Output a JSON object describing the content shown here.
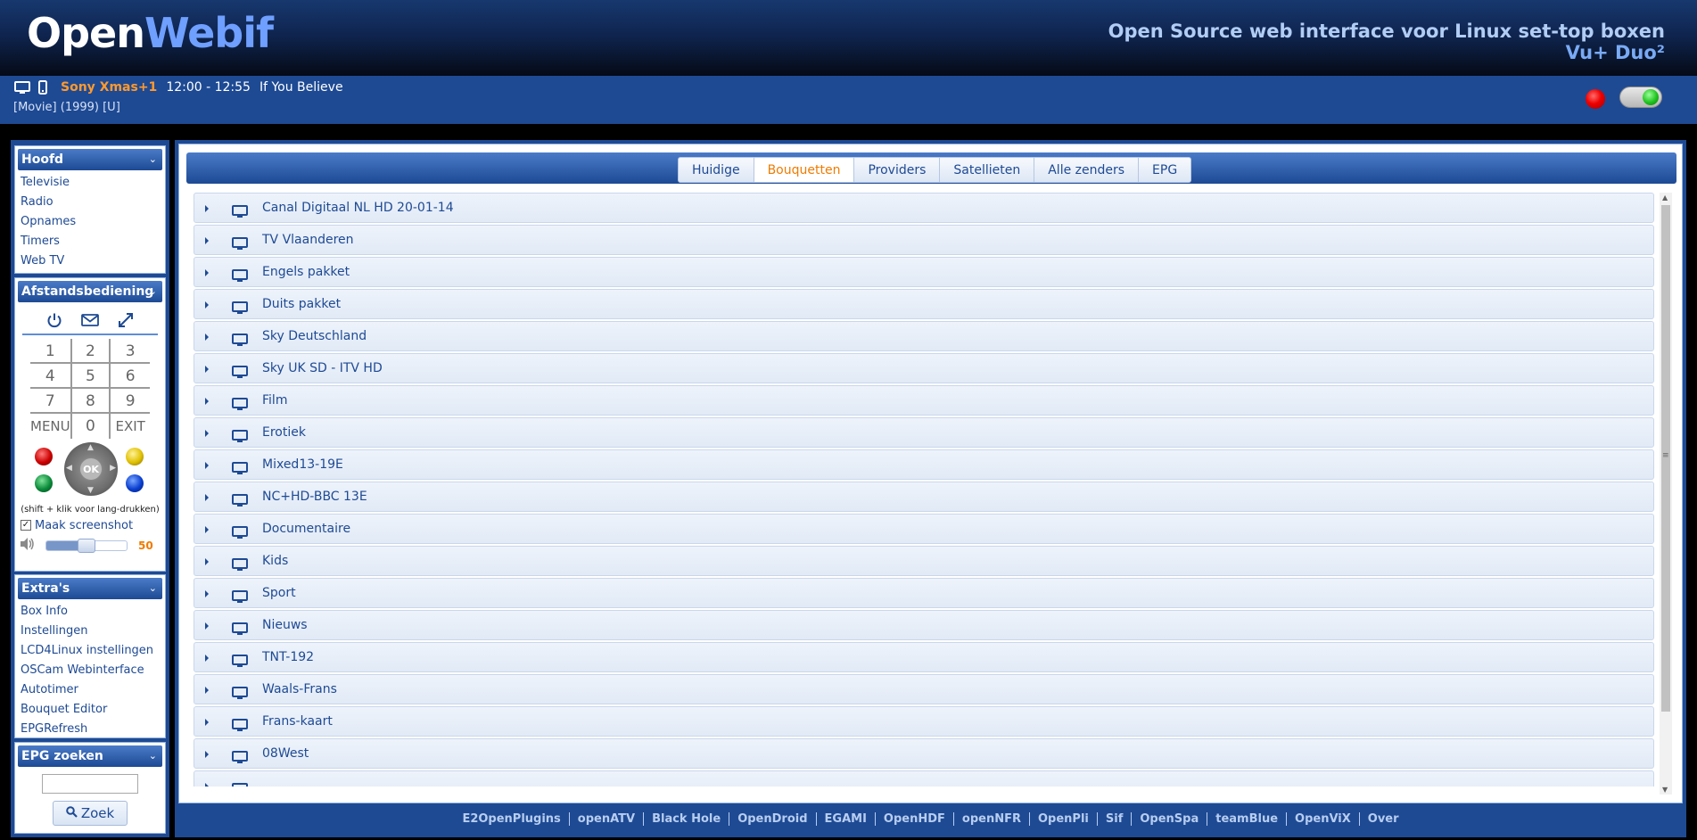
{
  "header": {
    "logo_part1": "Open",
    "logo_part2": "Webif",
    "tagline": "Open Source web interface voor Linux set-top boxen",
    "model": "Vu+ Duo²"
  },
  "now_playing": {
    "channel": "Sony Xmas+1",
    "time": "12:00 - 12:55",
    "title": "If You Believe",
    "details": "[Movie] (1999) [U]"
  },
  "sidebar": {
    "main": {
      "title": "Hoofd",
      "items": [
        "Televisie",
        "Radio",
        "Opnames",
        "Timers",
        "Web TV"
      ]
    },
    "remote": {
      "title": "Afstandsbediening",
      "keys": [
        "1",
        "2",
        "3",
        "4",
        "5",
        "6",
        "7",
        "8",
        "9",
        "MENU",
        "0",
        "EXIT"
      ],
      "ok_label": "OK",
      "hint": "(shift + klik voor lang-drukken)",
      "screenshot_label": "Maak screenshot",
      "screenshot_checked": true,
      "volume": 50
    },
    "extras": {
      "title": "Extra's",
      "items": [
        "Box Info",
        "Instellingen",
        "LCD4Linux instellingen",
        "OSCam Webinterface",
        "Autotimer",
        "Bouquet Editor",
        "EPGRefresh"
      ]
    },
    "epg_search": {
      "title": "EPG zoeken",
      "input_value": "",
      "button_label": "Zoek"
    }
  },
  "tabs": [
    {
      "label": "Huidige",
      "active": false
    },
    {
      "label": "Bouquetten",
      "active": true
    },
    {
      "label": "Providers",
      "active": false
    },
    {
      "label": "Satellieten",
      "active": false
    },
    {
      "label": "Alle zenders",
      "active": false
    },
    {
      "label": "EPG",
      "active": false
    }
  ],
  "bouquets": [
    "Canal Digitaal NL HD 20-01-14",
    "TV Vlaanderen",
    "Engels pakket",
    "Duits pakket",
    "Sky Deutschland",
    "Sky UK SD - ITV HD",
    "Film",
    "Erotiek",
    "Mixed13-19E",
    "NC+HD-BBC 13E",
    "Documentaire",
    "Kids",
    "Sport",
    "Nieuws",
    "TNT-192",
    "Waals-Frans",
    "Frans-kaart",
    "08West"
  ],
  "footer_links": [
    "E2OpenPlugins",
    "openATV",
    "Black Hole",
    "OpenDroid",
    "EGAMI",
    "OpenHDF",
    "openNFR",
    "OpenPli",
    "Sif",
    "OpenSpa",
    "teamBlue",
    "OpenViX",
    "Over"
  ],
  "colors": {
    "brand_blue": "#1e4a94",
    "accent_orange": "#ef7b00",
    "logo_blue": "#6f9fff"
  }
}
